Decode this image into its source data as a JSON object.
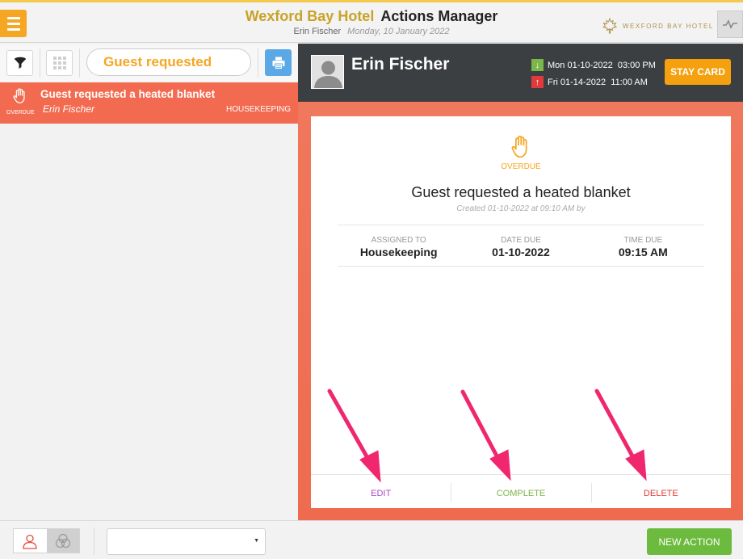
{
  "header": {
    "hotel_name": "Wexford Bay Hotel",
    "app_title": "Actions Manager",
    "user": "Erin Fischer",
    "date": "Monday, 10 January 2022",
    "brand_logo_text": "WEXFORD BAY HOTEL",
    "icons": {
      "menu": "hamburger-icon",
      "activity": "activity-icon",
      "brand": "maple-leaf-icon"
    }
  },
  "toolbar": {
    "search_value": "Guest requested",
    "icons": {
      "filter": "filter-icon",
      "grid": "grid-icon",
      "search": "search-icon",
      "clear": "clear-icon",
      "print": "print-icon"
    }
  },
  "list": {
    "items": [
      {
        "status": "OVERDUE",
        "title": "Guest requested a heated blanket",
        "guest": "Erin Fischer",
        "department": "HOUSEKEEPING",
        "icon": "hand-icon"
      }
    ]
  },
  "guest_panel": {
    "name": "Erin Fischer",
    "arrival": "Mon 01-10-2022  03:00 PM",
    "departure": "Fri 01-14-2022  11:00 AM",
    "stay_card_label": "STAY CARD"
  },
  "detail": {
    "status": "OVERDUE",
    "title": "Guest requested a heated blanket",
    "created": "Created 01-10-2022 at 09:10 AM by",
    "assigned_label": "ASSIGNED TO",
    "assigned_value": "Housekeeping",
    "date_due_label": "DATE DUE",
    "date_due_value": "01-10-2022",
    "time_due_label": "TIME DUE",
    "time_due_value": "09:15 AM",
    "edit_label": "EDIT",
    "complete_label": "COMPLETE",
    "delete_label": "DELETE"
  },
  "footer": {
    "select_value": "",
    "new_action_label": "NEW ACTION",
    "icons": {
      "person": "person-icon",
      "group": "group-icon"
    }
  },
  "colors": {
    "accent_orange": "#f5a623",
    "overdue_red": "#f26b50",
    "brand_gold": "#c9a227",
    "edit_purple": "#a64ec8",
    "complete_green": "#7ab648",
    "delete_red": "#e23a3a",
    "annotation_pink": "#f0266f"
  }
}
